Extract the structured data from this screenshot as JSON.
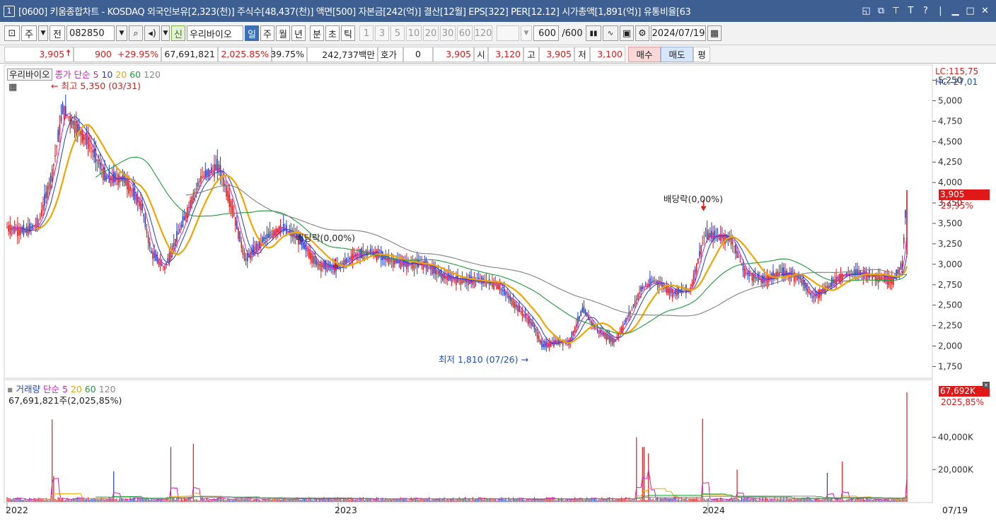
{
  "window": {
    "number": "1",
    "title": "[0600] 키움종합차트 - KOSDAQ 외국인보유[2,323(천)] 주식수[48,437(천)] 액면[500] 자본금[242(억)] 결산[12월] EPS[322] PER[12.12] 시가총액[1,891(억)] 유통비율[63"
  },
  "toolbar": {
    "period_type": "주",
    "jeon": "전",
    "code": "082850",
    "sin_badge": "신",
    "stock_name": "우리바이오",
    "periods": [
      "일",
      "주",
      "월",
      "년",
      "분",
      "초",
      "틱"
    ],
    "selected_period": "일",
    "intervals": [
      "1",
      "3",
      "5",
      "10",
      "20",
      "30",
      "60",
      "120"
    ],
    "count": "600",
    "count_max": "/600",
    "date": "2024/07/19"
  },
  "infobar": {
    "price": "3,905",
    "change": "900",
    "change_pct": "+29.95%",
    "volume": "67,691,821",
    "volume_pct": "2,025.85%",
    "turnover": "39.75%",
    "amount": "242,737백만",
    "hoga_label": "호가",
    "hoga_value": "0",
    "hoga_price": "3,905",
    "open_label": "시",
    "open": "3,120",
    "high_label": "고",
    "high": "3,905",
    "low_label": "저",
    "low": "3,100",
    "buy": "매수",
    "sell": "매도",
    "flat": "평"
  },
  "price_panel": {
    "name": "우리바이오",
    "legend_type": "종가 단순",
    "ma_periods": [
      "5",
      "10",
      "20",
      "60",
      "120"
    ],
    "ma_colors": [
      "#1d3fd0",
      "#1d3fd0",
      "#f0a500",
      "#1f9a3a",
      "#808080"
    ],
    "high_note": "최고 5,350 (03/31)",
    "low_note": "최저 1,810 (07/26)",
    "dividend_note_1": "배당락(0,00%)",
    "dividend_note_2": "배당락(0,00%)",
    "lc": "LC:115,75",
    "hc": "HC:-27,01",
    "current_price_tag": "3,905",
    "current_pct": "29,95%",
    "y_ticks": [
      "5,250",
      "5,000",
      "4,750",
      "4,500",
      "4,250",
      "4,000",
      "3,750",
      "3,500",
      "3,250",
      "3,000",
      "2,750",
      "2,500",
      "2,250",
      "2,000",
      "1,750"
    ]
  },
  "volume_panel": {
    "label": "거래량",
    "legend_type": "단순",
    "ma_periods": [
      "5",
      "20",
      "60",
      "120"
    ],
    "ma_colors": [
      "#d020c0",
      "#f0a500",
      "#1f9a3a",
      "#808080"
    ],
    "info": "67,691,821주(2,025,85%)",
    "current_tag": "67,692K",
    "current_pct": "2025,85%",
    "y_ticks": [
      "40,000K",
      "20,000K"
    ]
  },
  "x_axis": {
    "labels": [
      "2022",
      "2023",
      "2024"
    ],
    "last_date": "07/19"
  },
  "chart_data": {
    "type": "candlestick",
    "x_range": [
      "2022-01",
      "2024-07-19"
    ],
    "ylim": [
      1650,
      5350
    ],
    "price_anchors": [
      {
        "t": 0.0,
        "p": 3450
      },
      {
        "t": 0.02,
        "p": 3400
      },
      {
        "t": 0.035,
        "p": 3500
      },
      {
        "t": 0.05,
        "p": 4100
      },
      {
        "t": 0.062,
        "p": 4900
      },
      {
        "t": 0.075,
        "p": 4700
      },
      {
        "t": 0.09,
        "p": 4500
      },
      {
        "t": 0.11,
        "p": 4050
      },
      {
        "t": 0.13,
        "p": 4050
      },
      {
        "t": 0.15,
        "p": 3700
      },
      {
        "t": 0.16,
        "p": 3150
      },
      {
        "t": 0.175,
        "p": 2950
      },
      {
        "t": 0.195,
        "p": 3500
      },
      {
        "t": 0.215,
        "p": 4050
      },
      {
        "t": 0.235,
        "p": 4200
      },
      {
        "t": 0.25,
        "p": 3700
      },
      {
        "t": 0.265,
        "p": 3050
      },
      {
        "t": 0.285,
        "p": 3300
      },
      {
        "t": 0.305,
        "p": 3450
      },
      {
        "t": 0.325,
        "p": 3300
      },
      {
        "t": 0.345,
        "p": 3000
      },
      {
        "t": 0.365,
        "p": 2950
      },
      {
        "t": 0.385,
        "p": 3100
      },
      {
        "t": 0.405,
        "p": 3150
      },
      {
        "t": 0.425,
        "p": 3050
      },
      {
        "t": 0.445,
        "p": 3000
      },
      {
        "t": 0.465,
        "p": 3000
      },
      {
        "t": 0.485,
        "p": 2850
      },
      {
        "t": 0.505,
        "p": 2800
      },
      {
        "t": 0.525,
        "p": 2800
      },
      {
        "t": 0.545,
        "p": 2750
      },
      {
        "t": 0.565,
        "p": 2500
      },
      {
        "t": 0.585,
        "p": 2250
      },
      {
        "t": 0.595,
        "p": 2000
      },
      {
        "t": 0.61,
        "p": 2050
      },
      {
        "t": 0.625,
        "p": 2050
      },
      {
        "t": 0.64,
        "p": 2450
      },
      {
        "t": 0.655,
        "p": 2200
      },
      {
        "t": 0.675,
        "p": 2050
      },
      {
        "t": 0.69,
        "p": 2350
      },
      {
        "t": 0.705,
        "p": 2700
      },
      {
        "t": 0.72,
        "p": 2800
      },
      {
        "t": 0.74,
        "p": 2650
      },
      {
        "t": 0.76,
        "p": 2700
      },
      {
        "t": 0.775,
        "p": 3350
      },
      {
        "t": 0.79,
        "p": 3350
      },
      {
        "t": 0.805,
        "p": 3300
      },
      {
        "t": 0.82,
        "p": 2900
      },
      {
        "t": 0.84,
        "p": 2800
      },
      {
        "t": 0.86,
        "p": 2900
      },
      {
        "t": 0.88,
        "p": 2850
      },
      {
        "t": 0.895,
        "p": 2600
      },
      {
        "t": 0.91,
        "p": 2700
      },
      {
        "t": 0.925,
        "p": 2850
      },
      {
        "t": 0.945,
        "p": 2900
      },
      {
        "t": 0.965,
        "p": 2850
      },
      {
        "t": 0.985,
        "p": 2800
      },
      {
        "t": 0.995,
        "p": 3000
      },
      {
        "t": 1.0,
        "p": 3905
      }
    ],
    "volume_spikes_k": [
      {
        "t": 0.05,
        "v": 51000
      },
      {
        "t": 0.052,
        "v": 16000
      },
      {
        "t": 0.118,
        "v": 19000
      },
      {
        "t": 0.182,
        "v": 34000
      },
      {
        "t": 0.207,
        "v": 36000
      },
      {
        "t": 0.7,
        "v": 40000
      },
      {
        "t": 0.707,
        "v": 34000
      },
      {
        "t": 0.713,
        "v": 30000
      },
      {
        "t": 0.773,
        "v": 51500
      },
      {
        "t": 0.812,
        "v": 20000
      },
      {
        "t": 0.912,
        "v": 18000
      },
      {
        "t": 0.928,
        "v": 25000
      },
      {
        "t": 1.0,
        "v": 67692
      }
    ],
    "volume_ylim": [
      0,
      70000
    ]
  }
}
